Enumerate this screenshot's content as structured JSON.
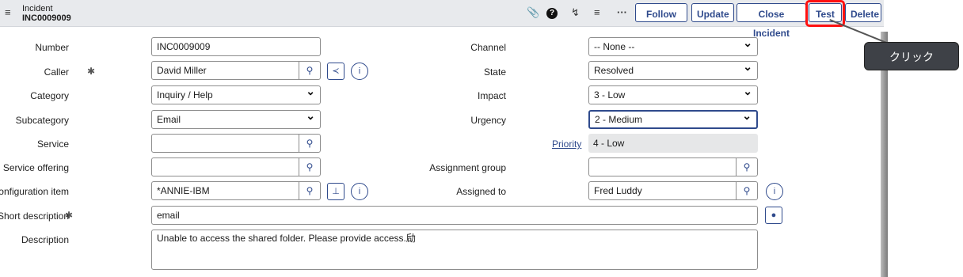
{
  "header": {
    "menu_icon": "hamburger-icon",
    "title_line1": "Incident",
    "title_line2": "INC0009009",
    "icons": [
      "paperclip-icon",
      "help-icon",
      "activity-icon",
      "settings-icon",
      "more-icon"
    ],
    "buttons": {
      "follow": "Follow",
      "update": "Update",
      "close_incident": "Close Incident",
      "test": "Test",
      "delete": "Delete"
    }
  },
  "form": {
    "number": {
      "label": "Number",
      "value": "INC0009009"
    },
    "caller": {
      "label": "Caller",
      "value": "David Miller"
    },
    "category": {
      "label": "Category",
      "value": "Inquiry / Help"
    },
    "subcategory": {
      "label": "Subcategory",
      "value": "Email"
    },
    "service": {
      "label": "Service",
      "value": ""
    },
    "service_offering": {
      "label": "Service offering",
      "value": ""
    },
    "configuration_item": {
      "label": "Configuration item",
      "value": "*ANNIE-IBM"
    },
    "short_description": {
      "label": "Short description",
      "value": "email"
    },
    "description": {
      "label": "Description",
      "value": "Unable to access the shared folder. Please provide access.劶"
    },
    "channel": {
      "label": "Channel",
      "value": "-- None --"
    },
    "state": {
      "label": "State",
      "value": "Resolved"
    },
    "impact": {
      "label": "Impact",
      "value": "3 - Low"
    },
    "urgency": {
      "label": "Urgency",
      "value": "2 - Medium"
    },
    "priority": {
      "label": "Priority",
      "value": "4 - Low"
    },
    "assignment_group": {
      "label": "Assignment group",
      "value": ""
    },
    "assigned_to": {
      "label": "Assigned to",
      "value": "Fred Luddy"
    }
  },
  "annotation": {
    "callout_text": "クリック",
    "highlight_color": "#ff1010"
  }
}
